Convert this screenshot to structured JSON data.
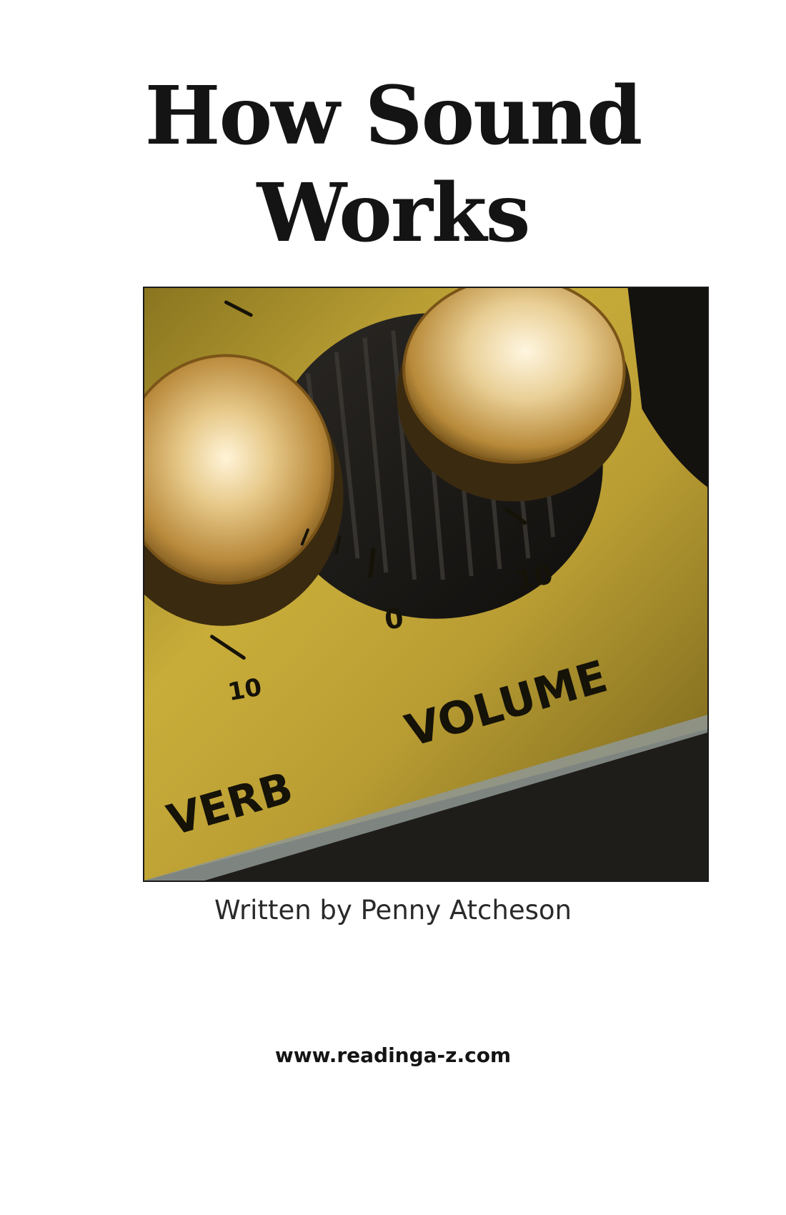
{
  "cover": {
    "title_line1": "How Sound",
    "title_line2": "Works",
    "byline": "Written by Penny Atcheson",
    "website": "www.readinga-z.com"
  },
  "photo": {
    "labels": {
      "reverb": "VERB",
      "volume": "VOLUME",
      "tick_10_left": "10",
      "tick_0": "0",
      "tick_10_right": "10"
    }
  },
  "colors": {
    "text": "#141414",
    "panel_gold": "#b89b2e",
    "knob_gold": "#d9b56a",
    "knob_dark": "#1a1815"
  }
}
